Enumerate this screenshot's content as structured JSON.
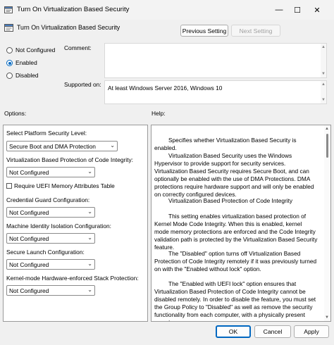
{
  "window": {
    "title": "Turn On Virtualization Based Security",
    "minimize": "—",
    "maximize": "☐",
    "close": "✕"
  },
  "header": {
    "policy_name": "Turn On Virtualization Based Security",
    "prev_label": "Previous Setting",
    "next_label": "Next Setting"
  },
  "state": {
    "not_configured": "Not Configured",
    "enabled": "Enabled",
    "disabled": "Disabled",
    "selected": "Enabled"
  },
  "comment": {
    "label": "Comment:",
    "value": ""
  },
  "supported": {
    "label": "Supported on:",
    "value": "At least Windows Server 2016, Windows 10"
  },
  "options": {
    "header": "Options:",
    "platform": {
      "label": "Select Platform Security Level:",
      "value": "Secure Boot and DMA Protection"
    },
    "code_integrity": {
      "label": "Virtualization Based Protection of Code Integrity:",
      "value": "Not Configured"
    },
    "uefi_check": {
      "label": "Require UEFI Memory Attributes Table",
      "checked": false
    },
    "credential_guard": {
      "label": "Credential Guard Configuration:",
      "value": "Not Configured"
    },
    "machine_identity": {
      "label": "Machine Identity Isolation Configuration:",
      "value": "Not Configured"
    },
    "secure_launch": {
      "label": "Secure Launch Configuration:",
      "value": "Not Configured"
    },
    "kernel_stack": {
      "label": "Kernel-mode Hardware-enforced Stack Protection:",
      "value": "Not Configured"
    }
  },
  "help": {
    "header": "Help:",
    "p1": "Specifies whether Virtualization Based Security is enabled.",
    "p2": "Virtualization Based Security uses the Windows Hypervisor to provide support for security services. Virtualization Based Security requires Secure Boot, and can optionally be enabled with the use of DMA Protections. DMA protections require hardware support and will only be enabled on correctly configured devices.",
    "p3": "Virtualization Based Protection of Code Integrity",
    "p4": "This setting enables virtualization based protection of Kernel Mode Code Integrity. When this is enabled, kernel mode memory protections are enforced and the Code Integrity validation path is protected by the Virtualization Based Security feature.",
    "p5": "The \"Disabled\" option turns off Virtualization Based Protection of Code Integrity remotely if it was previously turned on with the \"Enabled without lock\" option.",
    "p6": "The \"Enabled with UEFI lock\" option ensures that Virtualization Based Protection of Code Integrity cannot be disabled remotely. In order to disable the feature, you must set the Group Policy to \"Disabled\" as well as remove the security functionality from each computer, with a physically present user, in"
  },
  "footer": {
    "ok": "OK",
    "cancel": "Cancel",
    "apply": "Apply"
  }
}
